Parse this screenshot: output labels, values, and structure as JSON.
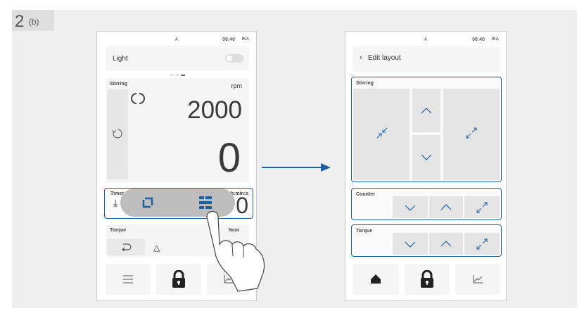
{
  "step": {
    "number": "2",
    "sub": "(b)"
  },
  "status": {
    "a_label": "A",
    "time": "08:40",
    "brand": "IKA"
  },
  "left_screen": {
    "light": {
      "label": "Light",
      "on": false
    },
    "stirring": {
      "label": "Stirring",
      "unit": "rpm",
      "set_value": "2000",
      "actual_value": "0"
    },
    "timer": {
      "label": "Timer",
      "unit": "h:min:s",
      "value": "0"
    },
    "torque": {
      "label": "Torque",
      "unit": "Ncm",
      "delta_symbol": "△"
    },
    "nav": {
      "menu_icon": "menu-icon",
      "lock_icon": "lock-icon",
      "graph_icon": "graph-icon"
    },
    "popup_icons": [
      "swap-icon",
      "layout-grid-icon"
    ]
  },
  "right_screen": {
    "header": {
      "back": "‹",
      "title": "Edit layout"
    },
    "stirring": {
      "label": "Stirring"
    },
    "counter": {
      "label": "Counter"
    },
    "torque": {
      "label": "Torque"
    },
    "nav": {
      "home_icon": "home-icon",
      "lock_icon": "lock-icon",
      "graph_icon": "graph-icon"
    }
  },
  "colors": {
    "accent": "#1d5fa0",
    "panel_bg": "#efefef",
    "card_bg": "#f5f5f5",
    "tile_bg": "#e4e4e4"
  }
}
